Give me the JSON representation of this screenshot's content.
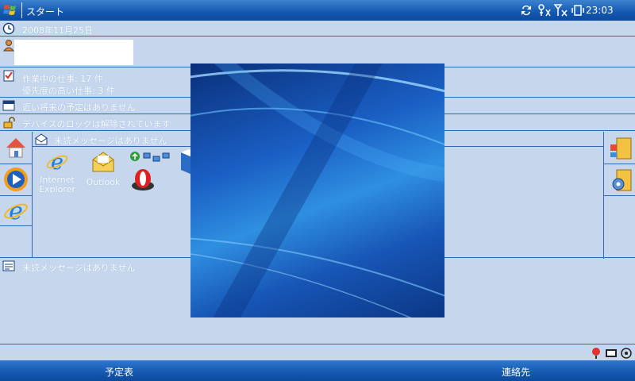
{
  "titlebar": {
    "title": "スタート",
    "clock": "23:03"
  },
  "today": {
    "date": "2008年11月25日",
    "tasks_active": "作業中の仕事: 17 件",
    "tasks_high": "優先度の高い仕事: 3 件",
    "calendar": "近い将来の予定はありません",
    "device_lock": "デバイスのロックは解除されています",
    "messages_top": "未読メッセージはありません",
    "messages_bottom": "未読メッセージはありません"
  },
  "apps": [
    {
      "label": "Internet\nExplorer",
      "icon": "internet-explorer-icon"
    },
    {
      "label": "Outlook",
      "icon": "outlook-mail-icon"
    }
  ],
  "softkeys": {
    "left": "予定表",
    "right": "連絡先"
  },
  "colors": {
    "titlebar": "#1558b0",
    "today_bg": "#c6d7ed",
    "divider": "#2f6ab8"
  }
}
